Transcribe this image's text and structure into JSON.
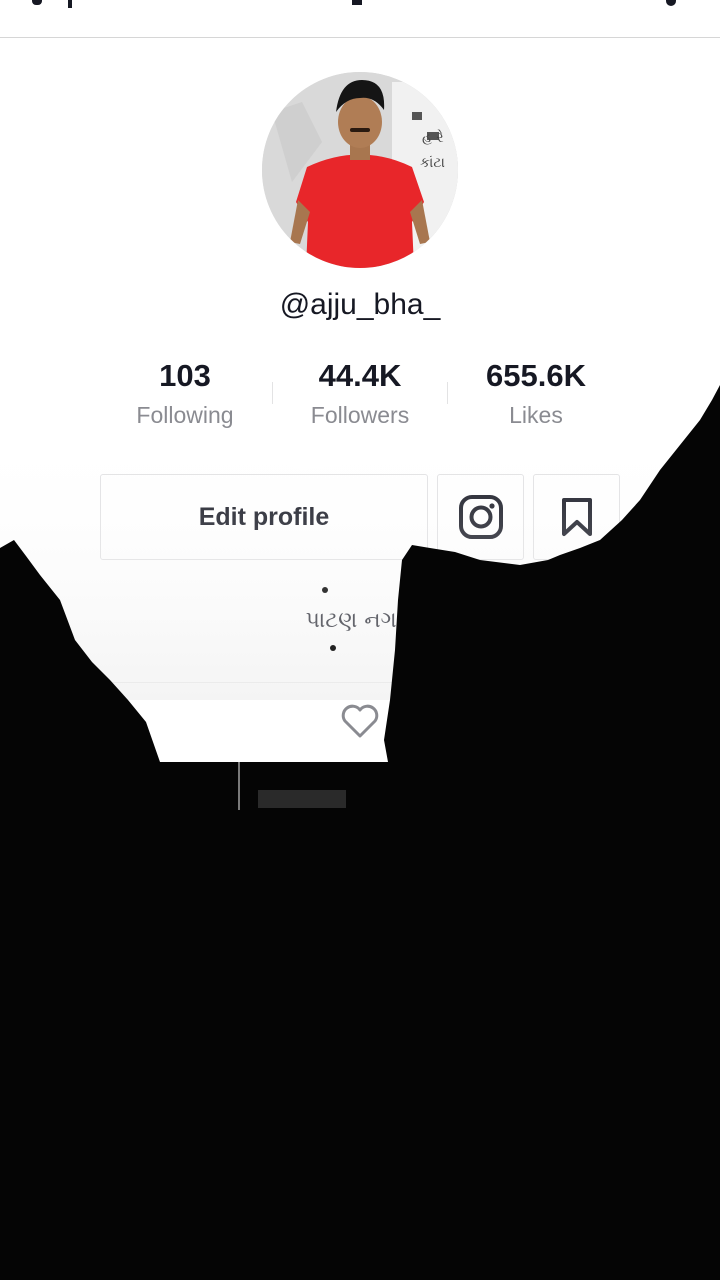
{
  "profile": {
    "username": "@ajju_bha_",
    "bio": "પાટણ નગરી"
  },
  "stats": {
    "following": {
      "value": "103",
      "label": "Following"
    },
    "followers": {
      "value": "44.4K",
      "label": "Followers"
    },
    "likes": {
      "value": "655.6K",
      "label": "Likes"
    }
  },
  "actions": {
    "edit_profile": "Edit profile",
    "instagram_icon": "instagram-icon",
    "bookmark_icon": "bookmark-icon"
  },
  "tabs": {
    "liked_icon": "heart-outline-icon"
  },
  "colors": {
    "text_primary": "#161823",
    "text_secondary": "#8a8b91",
    "border": "#e1e1e3"
  }
}
